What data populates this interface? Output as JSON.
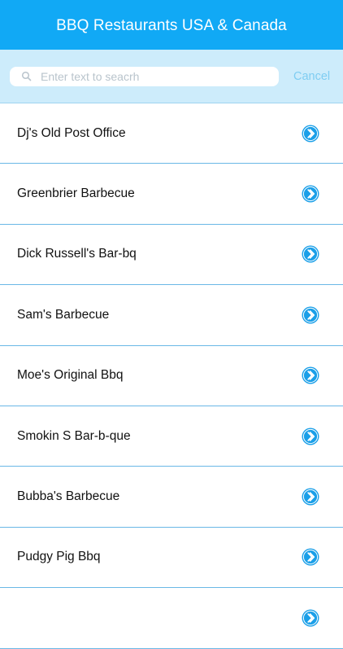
{
  "header": {
    "title": "BBQ Restaurants USA & Canada"
  },
  "search": {
    "placeholder": "Enter text to seacrh",
    "cancel_label": "Cancel"
  },
  "restaurants": [
    {
      "name": "Dj's Old Post Office"
    },
    {
      "name": "Greenbrier Barbecue"
    },
    {
      "name": "Dick Russell's Bar-bq"
    },
    {
      "name": "Sam's Barbecue"
    },
    {
      "name": "Moe's Original Bbq"
    },
    {
      "name": "Smokin S Bar-b-que"
    },
    {
      "name": "Bubba's Barbecue"
    },
    {
      "name": "Pudgy Pig Bbq"
    },
    {
      "name": ""
    }
  ],
  "icons": {
    "row_disclosure": "chevron-right-circle-icon",
    "search": "search-icon"
  },
  "colors": {
    "nav_background": "#11a9f5",
    "search_background": "#cdecfb",
    "accent": "#1a9fe8",
    "cancel_text": "#7fcdf2",
    "separator": "#6ab8e6"
  }
}
